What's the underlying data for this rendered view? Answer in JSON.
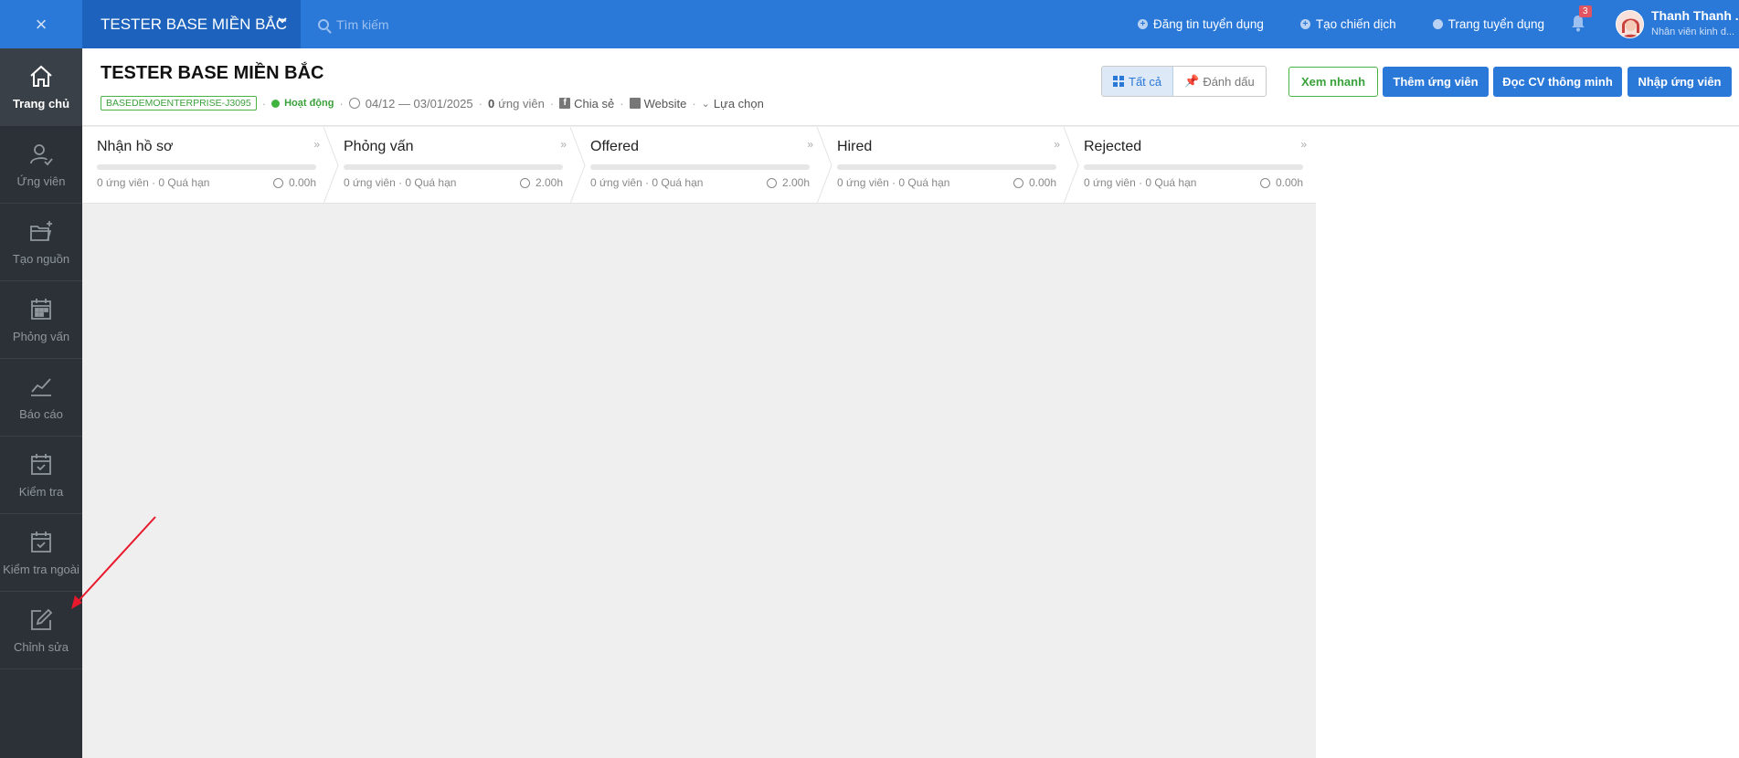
{
  "topbar": {
    "close_icon": "×",
    "project": "TESTER BASE MIỀN BẮC",
    "search_placeholder": "Tìm kiếm",
    "links": [
      {
        "label": "Đăng tin tuyển dụng",
        "icon": "plus-circle-icon"
      },
      {
        "label": "Tạo chiến dịch",
        "icon": "plus-circle-icon"
      },
      {
        "label": "Trang tuyển dụng",
        "icon": "globe-icon"
      }
    ],
    "notification_count": "3",
    "user_name": "Thanh Thanh ...",
    "user_role": "Nhân viên kinh d..."
  },
  "sidebar": {
    "items": [
      {
        "label": "Trang chủ",
        "icon": "home-icon",
        "active": true
      },
      {
        "label": "Ứng viên",
        "icon": "user-check-icon"
      },
      {
        "label": "Tạo nguồn",
        "icon": "folder-plus-icon"
      },
      {
        "label": "Phỏng vấn",
        "icon": "calendar-grid-icon"
      },
      {
        "label": "Báo cáo",
        "icon": "chart-line-icon"
      },
      {
        "label": "Kiểm tra",
        "icon": "calendar-check-icon"
      },
      {
        "label": "Kiểm tra ngoài",
        "icon": "calendar-check-icon"
      },
      {
        "label": "Chỉnh sửa",
        "icon": "edit-icon"
      }
    ]
  },
  "header": {
    "title": "TESTER BASE MIỀN BẮC",
    "code": "BASEDEMOENTERPRISE-J3095",
    "status": "Hoạt động",
    "date_range": "04/12 — 03/01/2025",
    "candidates_count": "0",
    "candidates_label": "ứng viên",
    "share": "Chia sẻ",
    "website": "Website",
    "options": "Lựa chọn",
    "toggle_all": "Tất cả",
    "toggle_marked": "Đánh dấu",
    "btn_quick_view": "Xem nhanh",
    "btn_add_candidate": "Thêm ứng viên",
    "btn_read_cv": "Đọc CV thông minh",
    "btn_import": "Nhập ứng viên"
  },
  "pipeline": {
    "stages": [
      {
        "name": "Nhận hồ sơ",
        "info": "0 ứng viên · 0 Quá hạn",
        "time": "0.00h"
      },
      {
        "name": "Phỏng vấn",
        "info": "0 ứng viên · 0 Quá hạn",
        "time": "2.00h"
      },
      {
        "name": "Offered",
        "info": "0 ứng viên · 0 Quá hạn",
        "time": "2.00h"
      },
      {
        "name": "Hired",
        "info": "0 ứng viên · 0 Quá hạn",
        "time": "0.00h"
      },
      {
        "name": "Rejected",
        "info": "0 ứng viên · 0 Quá hạn",
        "time": "0.00h"
      }
    ]
  },
  "colors": {
    "topbar": "#2a78d8",
    "sidebar": "#2b3136",
    "accent_green": "#3aa13a",
    "annotation_arrow": "#e8192c"
  }
}
